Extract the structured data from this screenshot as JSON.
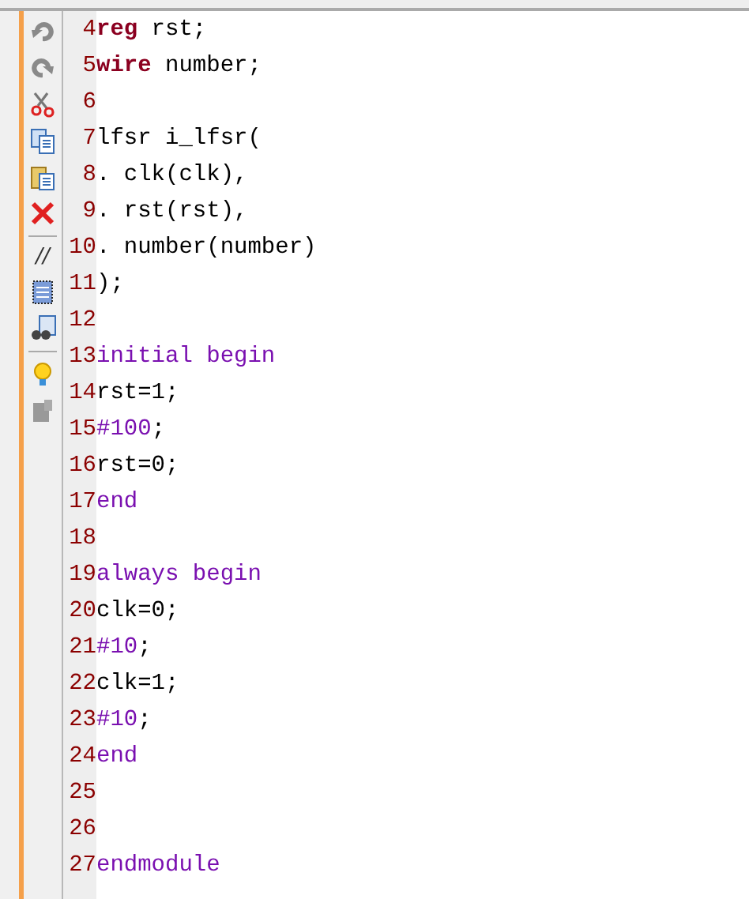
{
  "toolbar": {
    "comment_label": "//"
  },
  "lines": [
    {
      "number": "4",
      "tokens": [
        {
          "kind": "keyword",
          "text": "reg"
        },
        {
          "kind": "plain",
          "text": " rst;"
        }
      ]
    },
    {
      "number": "5",
      "tokens": [
        {
          "kind": "keyword",
          "text": "wire"
        },
        {
          "kind": "plain",
          "text": " number;"
        }
      ]
    },
    {
      "number": "6"
    },
    {
      "number": "7",
      "tokens": [
        {
          "kind": "plain",
          "text": "lfsr i_lfsr("
        }
      ]
    },
    {
      "number": "8",
      "tokens": [
        {
          "kind": "plain",
          "text": ". clk(clk),"
        }
      ]
    },
    {
      "number": "9",
      "tokens": [
        {
          "kind": "plain",
          "text": ". rst(rst),"
        }
      ]
    },
    {
      "number": "10",
      "tokens": [
        {
          "kind": "plain",
          "text": ". number(number)"
        }
      ]
    },
    {
      "number": "11",
      "tokens": [
        {
          "kind": "plain",
          "text": ");"
        }
      ]
    },
    {
      "number": "12"
    },
    {
      "number": "13",
      "tokens": [
        {
          "kind": "purple",
          "text": "initial begin"
        }
      ]
    },
    {
      "number": "14",
      "tokens": [
        {
          "kind": "plain",
          "text": "rst=1;"
        }
      ]
    },
    {
      "number": "15",
      "tokens": [
        {
          "kind": "purple",
          "text": "#100"
        },
        {
          "kind": "plain",
          "text": ";"
        }
      ]
    },
    {
      "number": "16",
      "tokens": [
        {
          "kind": "plain",
          "text": "rst=0;"
        }
      ]
    },
    {
      "number": "17",
      "tokens": [
        {
          "kind": "purple",
          "text": "end"
        }
      ]
    },
    {
      "number": "18"
    },
    {
      "number": "19",
      "tokens": [
        {
          "kind": "purple",
          "text": "always begin"
        }
      ]
    },
    {
      "number": "20",
      "tokens": [
        {
          "kind": "plain",
          "text": "clk=0;"
        }
      ]
    },
    {
      "number": "21",
      "tokens": [
        {
          "kind": "purple",
          "text": "#10"
        },
        {
          "kind": "plain",
          "text": ";"
        }
      ]
    },
    {
      "number": "22",
      "tokens": [
        {
          "kind": "plain",
          "text": "clk=1;"
        }
      ]
    },
    {
      "number": "23",
      "tokens": [
        {
          "kind": "purple",
          "text": "#10"
        },
        {
          "kind": "plain",
          "text": ";"
        }
      ]
    },
    {
      "number": "24",
      "tokens": [
        {
          "kind": "purple",
          "text": "end"
        }
      ]
    },
    {
      "number": "25"
    },
    {
      "number": "26"
    },
    {
      "number": "27",
      "tokens": [
        {
          "kind": "purple",
          "text": "endmodule"
        }
      ]
    }
  ]
}
